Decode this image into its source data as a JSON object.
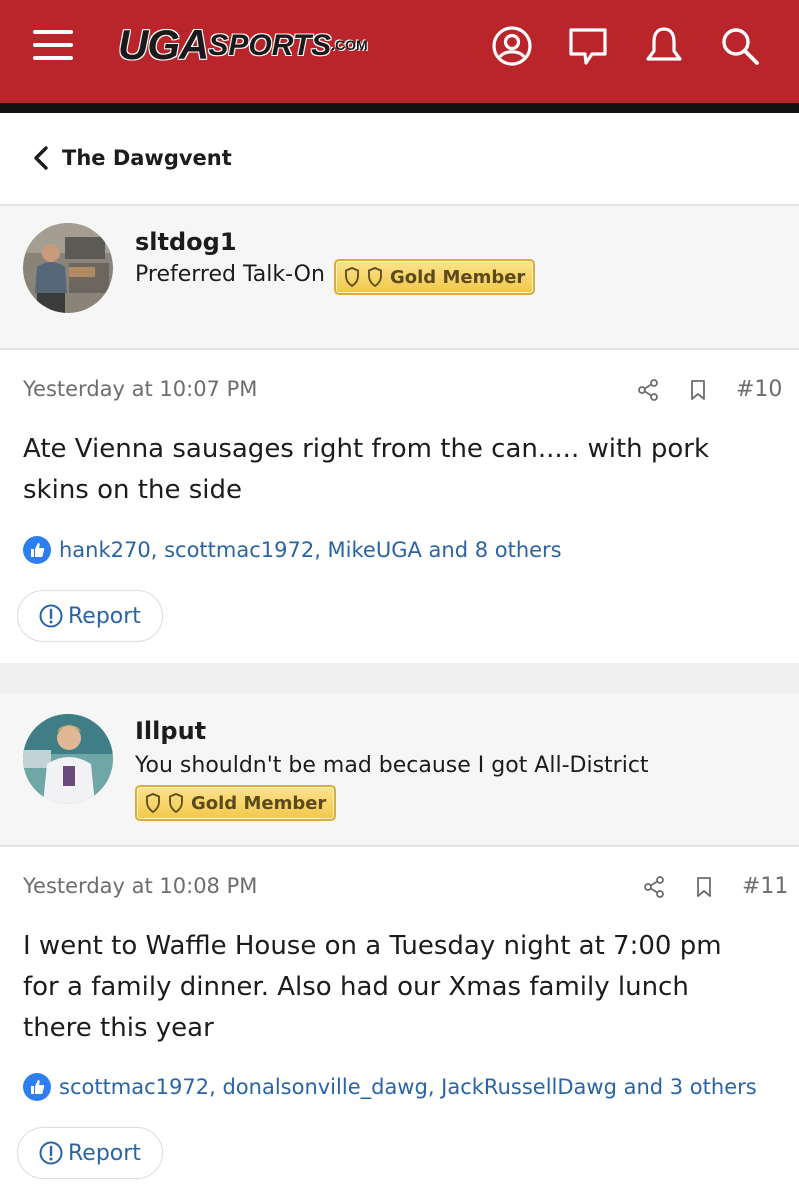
{
  "header": {
    "logo": {
      "uga": "UGA",
      "sports": "SPORTS",
      "com": ".COM"
    },
    "icons": [
      "menu-icon",
      "account-icon",
      "messages-icon",
      "alerts-icon",
      "search-icon"
    ],
    "brand_color": "#b9252a"
  },
  "breadcrumb": {
    "label": "The Dawgvent"
  },
  "posts": [
    {
      "author": "sltdog1",
      "user_title": "Preferred Talk-On",
      "badge": "Gold Member",
      "timestamp": "Yesterday at 10:07 PM",
      "post_number": "#10",
      "body": "Ate Vienna sausages right from the can..... with pork skins on the side",
      "reactions": "hank270, scottmac1972, MikeUGA and 8 others",
      "report_label": "Report"
    },
    {
      "author": "Illput",
      "user_title": "You shouldn't be mad because I got All-District",
      "badge": "Gold Member",
      "timestamp": "Yesterday at 10:08 PM",
      "post_number": "#11",
      "body": "I went to Waffle House on a Tuesday night at 7:00 pm for a family dinner. Also had our Xmas family lunch there this year",
      "reactions": "scottmac1972, donalsonville_dawg, JackRussellDawg and 3 others",
      "report_label": "Report"
    }
  ]
}
